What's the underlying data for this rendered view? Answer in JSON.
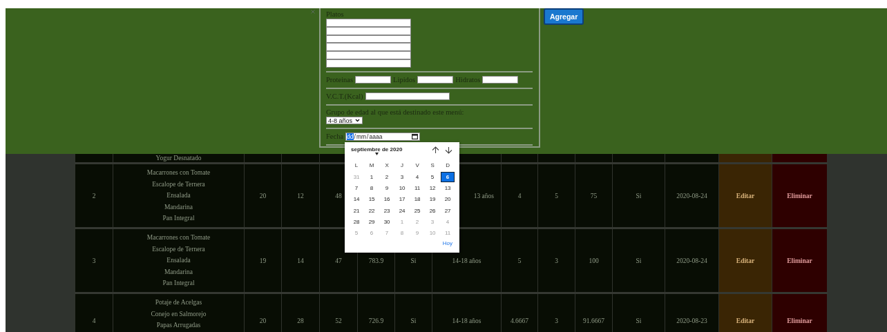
{
  "form": {
    "platos": {
      "label": "Platos",
      "fields": [
        {
          "kind": "blank"
        },
        {
          "kind": "blank"
        },
        {
          "kind": "blank"
        },
        {
          "kind": "blank"
        },
        {
          "kind": "blank"
        },
        {
          "kind": "blank"
        }
      ]
    },
    "nutrients": [
      {
        "label": "Proteinas"
      },
      {
        "label": "Lipidos"
      },
      {
        "label": "Hidratos"
      }
    ],
    "vct": {
      "label": "V.C.T.(Kcal)"
    },
    "age_group": {
      "label": "Grupo de edad al que está destinado este menú:",
      "value": "4-8 años"
    },
    "date": {
      "label": "Fecha",
      "separator": "/",
      "segments": [
        {
          "text": "dd",
          "selected": true
        },
        {
          "text": "mm",
          "selected": false
        },
        {
          "text": "aaaa",
          "selected": false
        }
      ]
    }
  },
  "add_button": "Agregar",
  "calendar": {
    "title": "septiembre de 2020",
    "weekdays": [
      "L",
      "M",
      "X",
      "J",
      "V",
      "S",
      "D"
    ],
    "days": [
      {
        "label": "31",
        "outside_month": true,
        "selected": false
      },
      {
        "label": "1",
        "outside_month": false,
        "selected": false
      },
      {
        "label": "2",
        "outside_month": false,
        "selected": false
      },
      {
        "label": "3",
        "outside_month": false,
        "selected": false
      },
      {
        "label": "4",
        "outside_month": false,
        "selected": false
      },
      {
        "label": "5",
        "outside_month": false,
        "selected": false
      },
      {
        "label": "6",
        "outside_month": false,
        "selected": true
      },
      {
        "label": "7",
        "outside_month": false,
        "selected": false
      },
      {
        "label": "8",
        "outside_month": false,
        "selected": false
      },
      {
        "label": "9",
        "outside_month": false,
        "selected": false
      },
      {
        "label": "10",
        "outside_month": false,
        "selected": false
      },
      {
        "label": "11",
        "outside_month": false,
        "selected": false
      },
      {
        "label": "12",
        "outside_month": false,
        "selected": false
      },
      {
        "label": "13",
        "outside_month": false,
        "selected": false
      },
      {
        "label": "14",
        "outside_month": false,
        "selected": false
      },
      {
        "label": "15",
        "outside_month": false,
        "selected": false
      },
      {
        "label": "16",
        "outside_month": false,
        "selected": false
      },
      {
        "label": "17",
        "outside_month": false,
        "selected": false
      },
      {
        "label": "18",
        "outside_month": false,
        "selected": false
      },
      {
        "label": "19",
        "outside_month": false,
        "selected": false
      },
      {
        "label": "20",
        "outside_month": false,
        "selected": false
      },
      {
        "label": "21",
        "outside_month": false,
        "selected": false
      },
      {
        "label": "22",
        "outside_month": false,
        "selected": false
      },
      {
        "label": "23",
        "outside_month": false,
        "selected": false
      },
      {
        "label": "24",
        "outside_month": false,
        "selected": false
      },
      {
        "label": "25",
        "outside_month": false,
        "selected": false
      },
      {
        "label": "26",
        "outside_month": false,
        "selected": false
      },
      {
        "label": "27",
        "outside_month": false,
        "selected": false
      },
      {
        "label": "28",
        "outside_month": false,
        "selected": false
      },
      {
        "label": "29",
        "outside_month": false,
        "selected": false
      },
      {
        "label": "30",
        "outside_month": false,
        "selected": false
      },
      {
        "label": "1",
        "outside_month": true,
        "selected": false
      },
      {
        "label": "2",
        "outside_month": true,
        "selected": false
      },
      {
        "label": "3",
        "outside_month": true,
        "selected": false
      },
      {
        "label": "4",
        "outside_month": true,
        "selected": false
      },
      {
        "label": "5",
        "outside_month": true,
        "selected": false
      },
      {
        "label": "6",
        "outside_month": true,
        "selected": false
      },
      {
        "label": "7",
        "outside_month": true,
        "selected": false
      },
      {
        "label": "8",
        "outside_month": true,
        "selected": false
      },
      {
        "label": "9",
        "outside_month": true,
        "selected": false
      },
      {
        "label": "10",
        "outside_month": true,
        "selected": false
      },
      {
        "label": "11",
        "outside_month": true,
        "selected": false
      }
    ],
    "today_button": "Hoy"
  },
  "table": {
    "rows": [
      {
        "number": null,
        "platos": [
          "Yogur Desnatado"
        ],
        "cells": [
          null,
          null,
          null,
          null,
          null,
          null,
          null,
          null,
          null,
          null,
          null
        ],
        "actions": [
          {
            "kind": "edit"
          },
          {
            "kind": "delete"
          }
        ]
      },
      {
        "number": "2",
        "platos": [
          "Macarrones con Tomate",
          "Escalope de Ternera",
          "Ensalada",
          "Mandarina",
          "Pan Integral"
        ],
        "cells": [
          "20",
          "12",
          "48",
          null,
          null,
          "13 años",
          "4",
          "5",
          "75",
          "Si",
          "2020-08-24"
        ],
        "actions": [
          {
            "kind": "edit",
            "label": "Editar"
          },
          {
            "kind": "delete",
            "label": "Eliminar"
          }
        ]
      },
      {
        "number": "3",
        "platos": [
          "Macarrones con Tomate",
          "Escalope de Ternera",
          "Ensalada",
          "Mandarina",
          "Pan Integral"
        ],
        "cells": [
          "19",
          "14",
          "47",
          "783.9",
          "Si",
          "14-18 años",
          "5",
          "3",
          "100",
          "Si",
          "2020-08-24"
        ],
        "actions": [
          {
            "kind": "edit",
            "label": "Editar"
          },
          {
            "kind": "delete",
            "label": "Eliminar"
          }
        ]
      },
      {
        "number": "4",
        "platos": [
          "Potaje de Acelgas",
          "Conejo en Salmorejo",
          "Papas Arrugadas"
        ],
        "cells": [
          "20",
          "28",
          "52",
          "726.9",
          "Si",
          "14-18 años",
          "4.6667",
          "3",
          "91.6667",
          "Si",
          "2020-08-23"
        ],
        "actions": [
          {
            "kind": "edit",
            "label": "Editar"
          },
          {
            "kind": "delete",
            "label": "Eliminar"
          }
        ]
      }
    ]
  }
}
